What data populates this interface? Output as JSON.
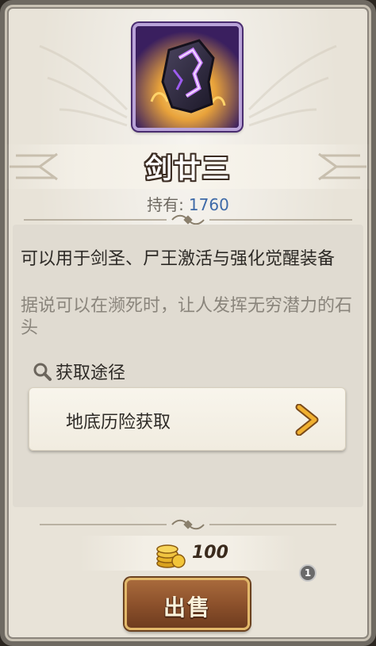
{
  "item": {
    "name": "剑廿三",
    "owned_label": "持有:",
    "owned_count": "1760",
    "description": "可以用于剑圣、尸王激活与强化觉醒装备",
    "flavor": "据说可以在濒死时，让人发挥无穷潜力的石头"
  },
  "sources": {
    "header": "获取途径",
    "items": [
      {
        "label": "地底历险获取"
      }
    ]
  },
  "sell": {
    "price": "100",
    "badge": "1",
    "button_label": "出售"
  },
  "colors": {
    "accent_blue": "#3e6aa8",
    "icon_bg": "#3a1f5f",
    "sell_button": "#8a4f2a"
  }
}
